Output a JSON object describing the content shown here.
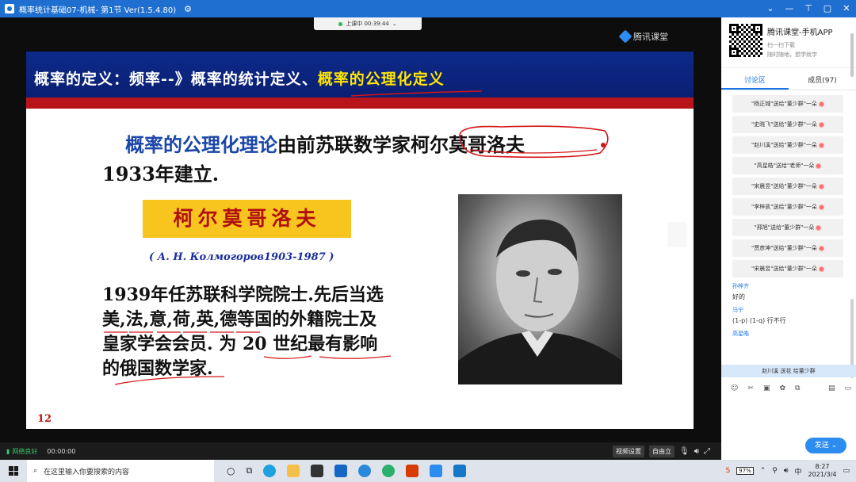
{
  "window": {
    "title": "概率统计基础07-机械- 第1节 Ver(1.5.4.80)",
    "controls": [
      "⌄",
      "—",
      "⊤",
      "▢",
      "✕"
    ]
  },
  "stage": {
    "status_text": "上课中 00:39:44",
    "status_chevron": "⌄",
    "brand": "腾讯课堂"
  },
  "slide": {
    "heading_prefix": "概率的定义：频率--》概率的统计定义、",
    "heading_highlight": "概率的公理化定义",
    "line1_blue": "概率的公理化理论",
    "line1_black": "由前苏联数学家",
    "line1_name": "柯尔莫哥洛夫",
    "line2": "1933年建立.",
    "name_box": "柯尔莫哥洛夫",
    "russian": "( А. Н.  Колмогоров1903-1987 )",
    "para_line1": "1939年任苏联科学院院士.先后当选",
    "para_line2_red": "美,法,意,荷,英,德",
    "para_line2_black": "等国的外籍院士及",
    "para_line3": "皇家学会会员. 为 20 世纪最有影响",
    "para_line4": "的俄国数学家.",
    "page_number": "12"
  },
  "stagebar": {
    "network": "网络良好",
    "elapsed": "00:00:00",
    "video_settings": "视频设置",
    "self_stand": "自由立",
    "mic_icon": "microphone-icon",
    "volume_icon": "speaker-icon",
    "fullscreen_icon": "fullscreen-icon"
  },
  "panel": {
    "app_title": "腾讯课堂-手机APP",
    "app_sub1": "扫一扫下载",
    "app_sub2": "随时随地，想学就学",
    "tab_discuss": "讨论区",
    "tab_members": "成员(97)",
    "gifts": [
      "\"杨正城\"送给\"董少群\"一朵",
      "\"史晓飞\"送给\"董少群\"一朵",
      "\"赵川溪\"送给\"董少群\"一朵",
      "\"高星皓\"送给\"老师\"一朵",
      "\"宋晨昱\"送给\"董少群\"一朵",
      "\"李梓凯\"送给\"董少群\"一朵",
      "\"邢旭\"送给\"董少群\"一朵",
      "\"贾彦坤\"送给\"董少群\"一朵",
      "\"宋晨昱\"送给\"董少群\"一朵"
    ],
    "messages": [
      {
        "user": "孙梓齐",
        "text": "好的"
      },
      {
        "user": "马宁",
        "text": "(1-p)   (1-q)   行不行"
      },
      {
        "user": "高星皓",
        "text": ""
      }
    ],
    "toast": "赵川溪 送花 给董少群",
    "send": "发送",
    "send_chevron": "⌄"
  },
  "taskbar": {
    "search_placeholder": "在这里输入你要搜索的内容",
    "battery": "97%",
    "time": "8:27",
    "date": "2021/3/4",
    "ime": "中"
  },
  "colors": {
    "title_bar": "#1f6fd0",
    "slide_header": "#0d2a8a",
    "slide_red_bar": "#b8141a",
    "name_box": "#f7c51e",
    "accent": "#2d8cf0"
  }
}
